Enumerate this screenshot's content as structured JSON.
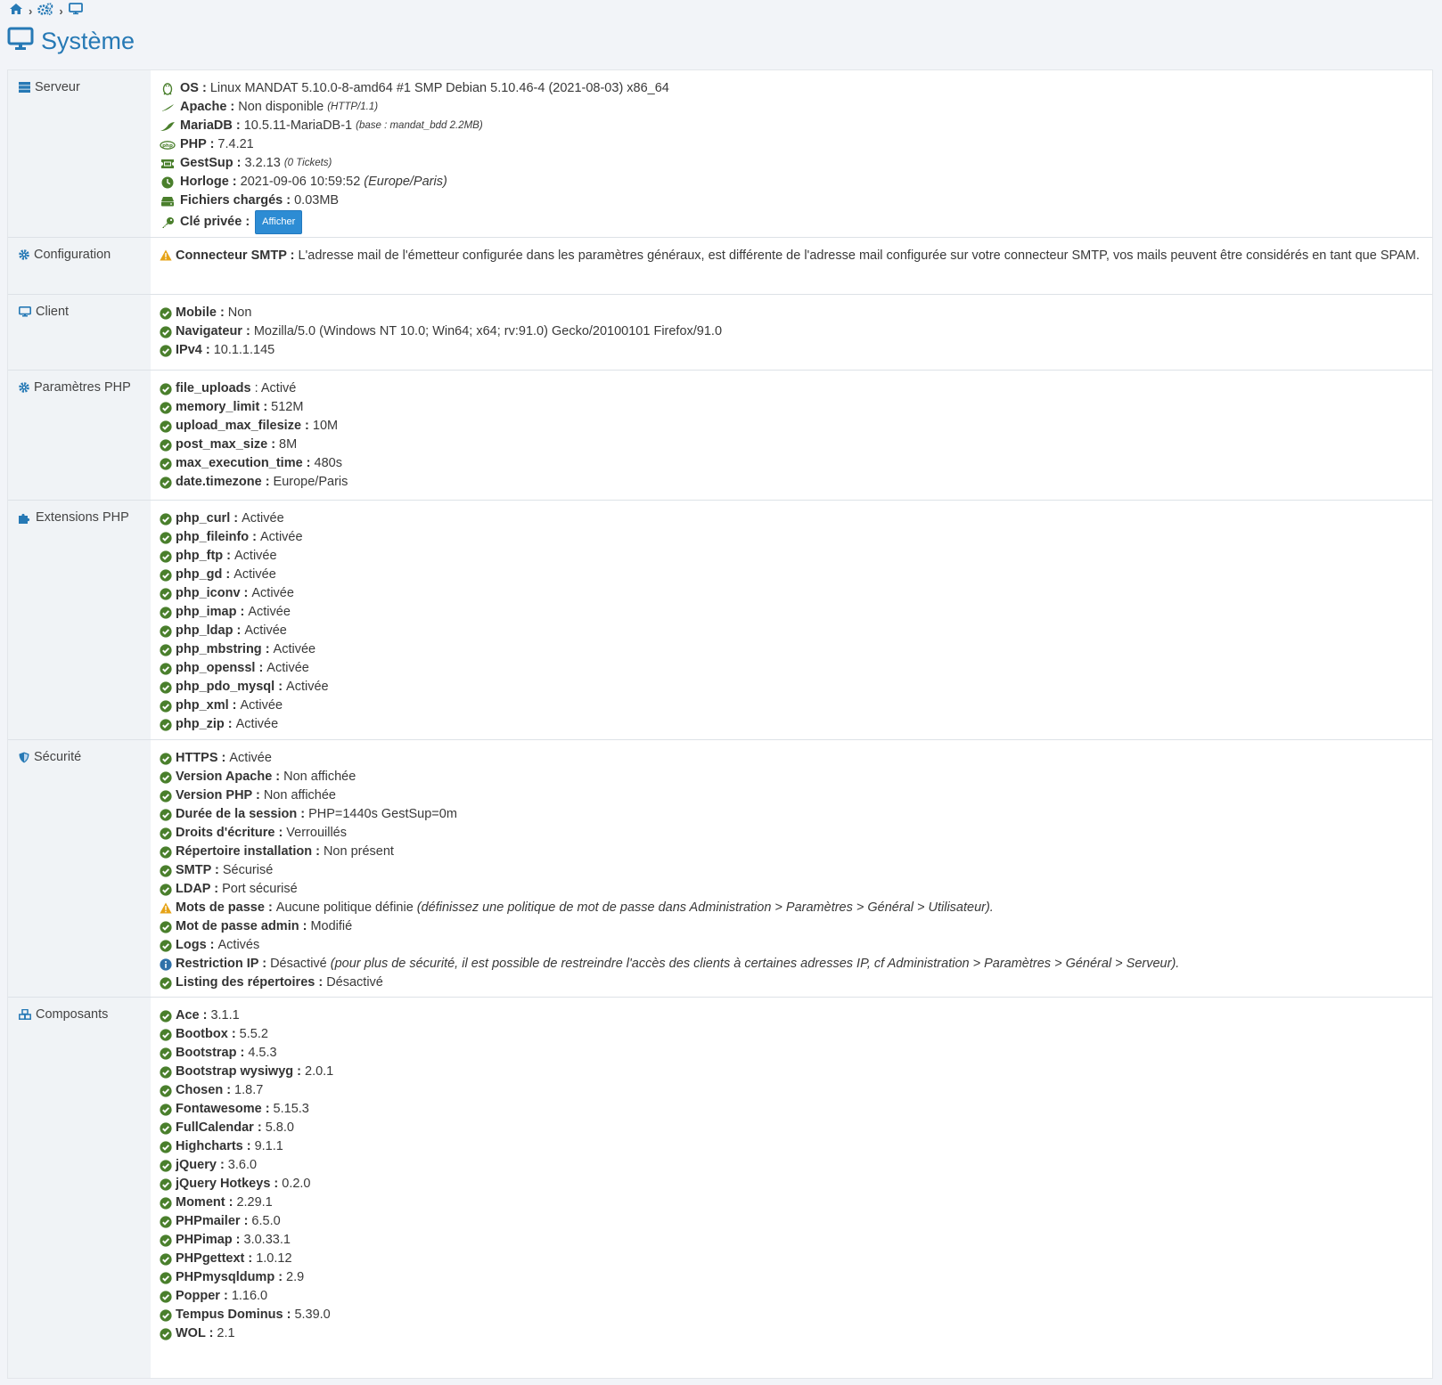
{
  "colors": {
    "accent": "#2679b5",
    "ok": "#4a7f2c",
    "warn": "#e6a317",
    "info": "#3071a9"
  },
  "breadcrumb": [
    {
      "icon": "home-icon"
    },
    {
      "icon": "cogs-icon"
    },
    {
      "icon": "desktop-icon"
    }
  ],
  "page_title": "Système",
  "server": {
    "label": "Serveur",
    "os_k": "OS :",
    "os_v": "Linux MANDAT 5.10.0-8-amd64 #1 SMP Debian 5.10.46-4 (2021-08-03) x86_64",
    "apache_k": "Apache :",
    "apache_v": "Non disponible",
    "apache_note": "(HTTP/1.1)",
    "mariadb_k": "MariaDB :",
    "mariadb_v": "10.5.11-MariaDB-1",
    "mariadb_note": "(base : mandat_bdd 2.2MB)",
    "php_k": "PHP :",
    "php_v": "7.4.21",
    "gestsup_k": "GestSup :",
    "gestsup_v": "3.2.13",
    "gestsup_note": "(0 Tickets)",
    "clock_k": "Horloge :",
    "clock_v": "2021-09-06 10:59:52",
    "clock_note": "(Europe/Paris)",
    "files_k": "Fichiers chargés :",
    "files_v": "0.03MB",
    "key_k": "Clé privée :",
    "key_button": "Afficher"
  },
  "config": {
    "label": "Configuration",
    "smtp_k": "Connecteur SMTP :",
    "smtp_v": "L'adresse mail de l'émetteur configurée dans les paramètres généraux, est différente de l'adresse mail configurée sur votre connecteur SMTP, vos mails peuvent être considérés en tant que SPAM."
  },
  "client": {
    "label": "Client",
    "items": [
      {
        "k": "Mobile :",
        "v": "Non"
      },
      {
        "k": "Navigateur :",
        "v": "Mozilla/5.0 (Windows NT 10.0; Win64; x64; rv:91.0) Gecko/20100101 Firefox/91.0"
      },
      {
        "k": "IPv4 :",
        "v": "10.1.1.145"
      }
    ]
  },
  "php_params": {
    "label": "Paramètres PHP",
    "items": [
      {
        "k": "file_uploads",
        "v": ": Activé"
      },
      {
        "k": "memory_limit :",
        "v": "512M"
      },
      {
        "k": "upload_max_filesize :",
        "v": "10M"
      },
      {
        "k": "post_max_size :",
        "v": "8M"
      },
      {
        "k": "max_execution_time :",
        "v": "480s"
      },
      {
        "k": "date.timezone :",
        "v": "Europe/Paris"
      }
    ]
  },
  "php_ext": {
    "label": "Extensions PHP",
    "items": [
      {
        "k": "php_curl :",
        "v": "Activée"
      },
      {
        "k": "php_fileinfo :",
        "v": "Activée"
      },
      {
        "k": "php_ftp :",
        "v": "Activée"
      },
      {
        "k": "php_gd :",
        "v": "Activée"
      },
      {
        "k": "php_iconv :",
        "v": "Activée"
      },
      {
        "k": "php_imap :",
        "v": "Activée"
      },
      {
        "k": "php_ldap :",
        "v": "Activée"
      },
      {
        "k": "php_mbstring :",
        "v": "Activée"
      },
      {
        "k": "php_openssl :",
        "v": "Activée"
      },
      {
        "k": "php_pdo_mysql :",
        "v": "Activée"
      },
      {
        "k": "php_xml :",
        "v": "Activée"
      },
      {
        "k": "php_zip :",
        "v": "Activée"
      }
    ]
  },
  "security": {
    "label": "Sécurité",
    "items": [
      {
        "k": "HTTPS :",
        "v": "Activée",
        "status": "ok"
      },
      {
        "k": "Version Apache :",
        "v": "Non affichée",
        "status": "ok"
      },
      {
        "k": "Version PHP :",
        "v": "Non affichée",
        "status": "ok"
      },
      {
        "k": "Durée de la session :",
        "v": "PHP=1440s GestSup=0m",
        "status": "ok"
      },
      {
        "k": "Droits d'écriture :",
        "v": "Verrouillés",
        "status": "ok"
      },
      {
        "k": "Répertoire installation :",
        "v": "Non présent",
        "status": "ok"
      },
      {
        "k": "SMTP :",
        "v": "Sécurisé",
        "status": "ok"
      },
      {
        "k": "LDAP :",
        "v": "Port sécurisé",
        "status": "ok"
      },
      {
        "k": "Mots de passe :",
        "v": "Aucune politique définie",
        "note": "(définissez une politique de mot de passe dans Administration > Paramètres > Général > Utilisateur).",
        "status": "warn"
      },
      {
        "k": "Mot de passe admin :",
        "v": "Modifié",
        "status": "ok"
      },
      {
        "k": "Logs :",
        "v": "Activés",
        "status": "ok"
      },
      {
        "k": "Restriction IP :",
        "v": "Désactivé",
        "note": "(pour plus de sécurité, il est possible de restreindre l'accès des clients à certaines adresses IP, cf Administration > Paramètres > Général > Serveur).",
        "status": "info"
      },
      {
        "k": "Listing des répertoires :",
        "v": "Désactivé",
        "status": "ok"
      }
    ]
  },
  "components": {
    "label": "Composants",
    "items": [
      {
        "k": "Ace :",
        "v": "3.1.1"
      },
      {
        "k": "Bootbox :",
        "v": "5.5.2"
      },
      {
        "k": "Bootstrap :",
        "v": "4.5.3"
      },
      {
        "k": "Bootstrap wysiwyg :",
        "v": "2.0.1"
      },
      {
        "k": "Chosen :",
        "v": "1.8.7"
      },
      {
        "k": "Fontawesome :",
        "v": "5.15.3"
      },
      {
        "k": "FullCalendar :",
        "v": "5.8.0"
      },
      {
        "k": "Highcharts :",
        "v": "9.1.1"
      },
      {
        "k": "jQuery :",
        "v": "3.6.0"
      },
      {
        "k": "jQuery Hotkeys :",
        "v": "0.2.0"
      },
      {
        "k": "Moment :",
        "v": "2.29.1"
      },
      {
        "k": "PHPmailer :",
        "v": "6.5.0"
      },
      {
        "k": "PHPimap :",
        "v": "3.0.33.1"
      },
      {
        "k": "PHPgettext :",
        "v": "1.0.12"
      },
      {
        "k": "PHPmysqldump :",
        "v": "2.9"
      },
      {
        "k": "Popper :",
        "v": "1.16.0"
      },
      {
        "k": "Tempus Dominus :",
        "v": "5.39.0"
      },
      {
        "k": "WOL :",
        "v": "2.1"
      }
    ]
  }
}
